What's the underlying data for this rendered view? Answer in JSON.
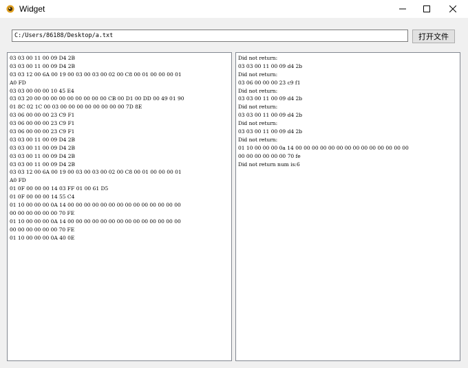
{
  "window": {
    "title": "Widget"
  },
  "toolbar": {
    "path_value": "C:/Users/86188/Desktop/a.txt",
    "open_button_label": "打开文件"
  },
  "left_panel": {
    "lines": [
      "03 03 00 11 00 09 D4 2B",
      "03 03 00 11 00 09 D4 2B",
      "03 03 12 00 6A 00 19 00 03 00 03 00 02 00 C8 00 01 00 00 00 01",
      "A0 FD",
      "03 03 00 00 00 10 45 E4",
      "03 03 20 00 00 00 00 00 00 00 00 00 CB 00 D1 00 DD 00 49 01 90",
      "01 8C 02 1C 00 03 00 00 00 00 00 00 00 00 7D 8E",
      "03 06 00 00 00 23 C9 F1",
      "03 06 00 00 00 23 C9 F1",
      "03 06 00 00 00 23 C9 F1",
      "03 03 00 11 00 09 D4 2B",
      "03 03 00 11 00 09 D4 2B",
      "03 03 00 11 00 09 D4 2B",
      "03 03 00 11 00 09 D4 2B",
      "03 03 12 00 6A 00 19 00 03 00 03 00 02 00 C8 00 01 00 00 00 01",
      "A0 FD",
      "01 0F 00 00 00 14 03 FF 01 00 61 D5",
      "01 0F 00 00 00 14 55 C4",
      "01 10 00 00 00 0A 14 00 00 00 00 00 00 00 00 00 00 00 00 00 00",
      "00 00 00 00 00 00 70 FE",
      "01 10 00 00 00 0A 14 00 00 00 00 00 00 00 00 00 00 00 00 00 00",
      "00 00 00 00 00 00 70 FE",
      "01 10 00 00 00 0A 40 0E"
    ]
  },
  "right_panel": {
    "lines": [
      "Did not return:",
      "03 03 00 11 00 09 d4 2b",
      "Did not return:",
      "03 06 00 00 00 23 c9 f1",
      "Did not return:",
      "03 03 00 11 00 09 d4 2b",
      "Did not return:",
      "03 03 00 11 00 09 d4 2b",
      "Did not return:",
      "03 03 00 11 00 09 d4 2b",
      "Did not return:",
      "01 10 00 00 00 0a 14 00 00 00 00 00 00 00 00 00 00 00 00 00 00",
      "00 00 00 00 00 00 70 fe",
      "Did not return num is:6"
    ]
  },
  "icons": {
    "app": "app-icon",
    "minimize": "minimize-icon",
    "maximize": "maximize-icon",
    "close": "close-icon"
  }
}
